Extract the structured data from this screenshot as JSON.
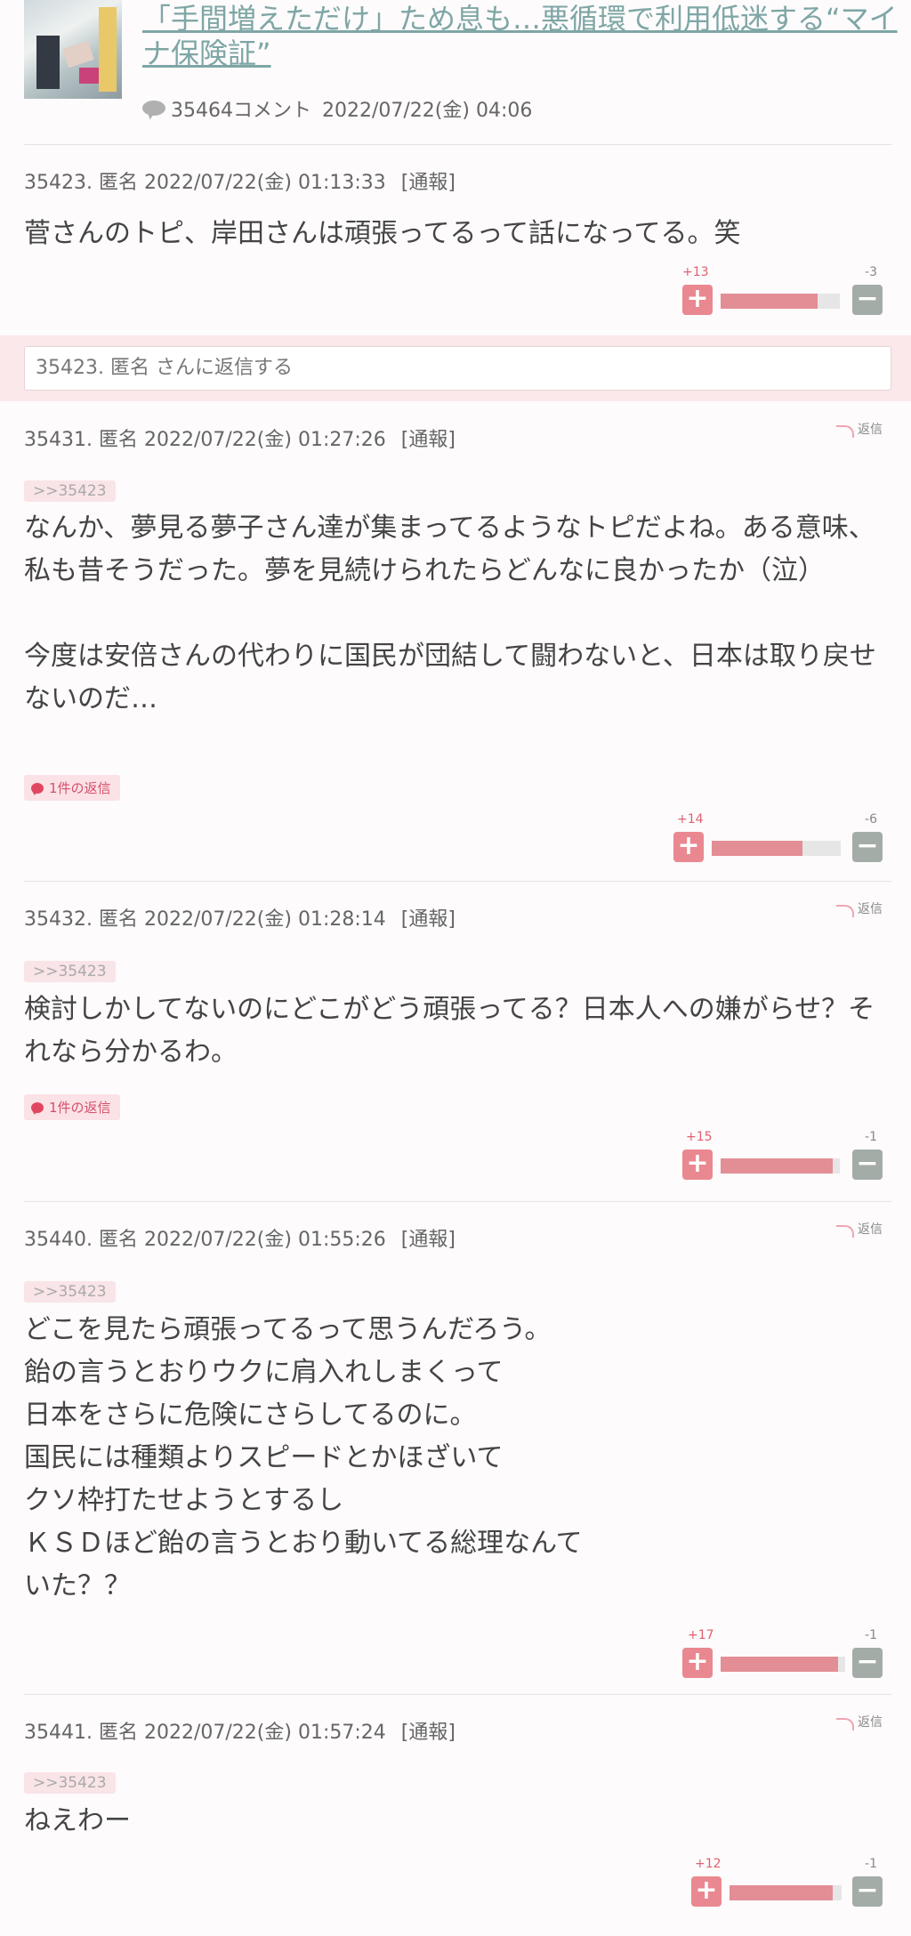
{
  "article": {
    "title": "「手間増えただけ」ため息も…悪循環で利用低迷する“マイナ保険証”",
    "comment_count": "35464コメント",
    "date": "2022/07/22(金) 04:06"
  },
  "reply_box": {
    "placeholder": "35423. 匿名 さんに返信する"
  },
  "labels": {
    "report": "[通報]",
    "reply": "返信"
  },
  "comments": [
    {
      "id": "35423. 匿名",
      "date": "2022/07/22(金) 01:13:33",
      "anchor": "",
      "body": "菅さんのトピ、岸田さんは頑張ってるって話になってる。笑",
      "reply_count": "",
      "plus": "+13",
      "minus": "-3",
      "plus_ratio": 0.81
    },
    {
      "id": "35431. 匿名",
      "date": "2022/07/22(金) 01:27:26",
      "anchor": ">>35423",
      "body": "なんか、夢見る夢子さん達が集まってるようなトピだよね。ある意味、私も昔そうだった。夢を見続けられたらどんなに良かったか（泣）\n\n今度は安倍さんの代わりに国民が団結して闘わないと、日本は取り戻せないのだ…",
      "reply_count": "1件の返信",
      "plus": "+14",
      "minus": "-6",
      "plus_ratio": 0.7
    },
    {
      "id": "35432. 匿名",
      "date": "2022/07/22(金) 01:28:14",
      "anchor": ">>35423",
      "body": "検討しかしてないのにどこがどう頑張ってる？日本人への嫌がらせ？それなら分かるわ。",
      "reply_count": "1件の返信",
      "plus": "+15",
      "minus": "-1",
      "plus_ratio": 0.94
    },
    {
      "id": "35440. 匿名",
      "date": "2022/07/22(金) 01:55:26",
      "anchor": ">>35423",
      "body": "どこを見たら頑張ってるって思うんだろう。\n飴の言うとおりウクに肩入れしまくって\n日本をさらに危険にさらしてるのに。\n国民には種類よりスピードとかほざいて\nクソ枠打たせようとするし\nＫＳＤほど飴の言うとおり動いてる総理なんて\nいた？？",
      "reply_count": "",
      "plus": "+17",
      "minus": "-1",
      "plus_ratio": 0.94
    },
    {
      "id": "35441. 匿名",
      "date": "2022/07/22(金) 01:57:24",
      "anchor": ">>35423",
      "body": "ねえわー",
      "reply_count": "",
      "plus": "+12",
      "minus": "-1",
      "plus_ratio": 0.92
    }
  ]
}
